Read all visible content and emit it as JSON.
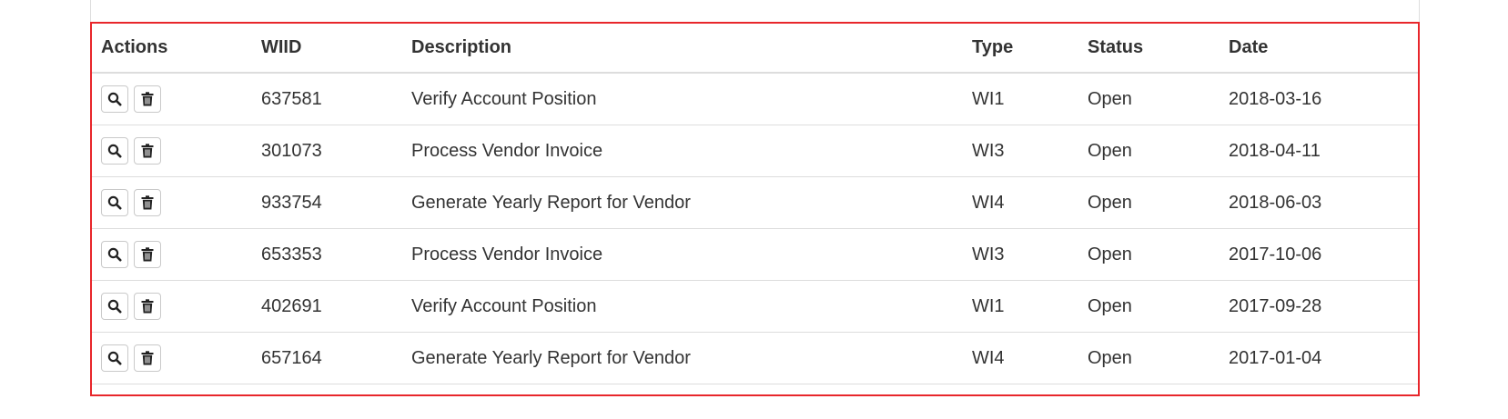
{
  "table": {
    "headers": {
      "actions": "Actions",
      "wiid": "WIID",
      "description": "Description",
      "type": "Type",
      "status": "Status",
      "date": "Date"
    },
    "rows": [
      {
        "wiid": "637581",
        "description": "Verify Account Position",
        "type": "WI1",
        "status": "Open",
        "date": "2018-03-16"
      },
      {
        "wiid": "301073",
        "description": "Process Vendor Invoice",
        "type": "WI3",
        "status": "Open",
        "date": "2018-04-11"
      },
      {
        "wiid": "933754",
        "description": "Generate Yearly Report for Vendor",
        "type": "WI4",
        "status": "Open",
        "date": "2018-06-03"
      },
      {
        "wiid": "653353",
        "description": "Process Vendor Invoice",
        "type": "WI3",
        "status": "Open",
        "date": "2017-10-06"
      },
      {
        "wiid": "402691",
        "description": "Verify Account Position",
        "type": "WI1",
        "status": "Open",
        "date": "2017-09-28"
      },
      {
        "wiid": "657164",
        "description": "Generate Yearly Report for Vendor",
        "type": "WI4",
        "status": "Open",
        "date": "2017-01-04"
      }
    ],
    "row_actions": [
      {
        "icon": "search-icon"
      },
      {
        "icon": "trash-icon"
      }
    ]
  },
  "colors": {
    "highlight_border": "#e8262b",
    "table_border": "#dddddd",
    "text": "#333333"
  }
}
